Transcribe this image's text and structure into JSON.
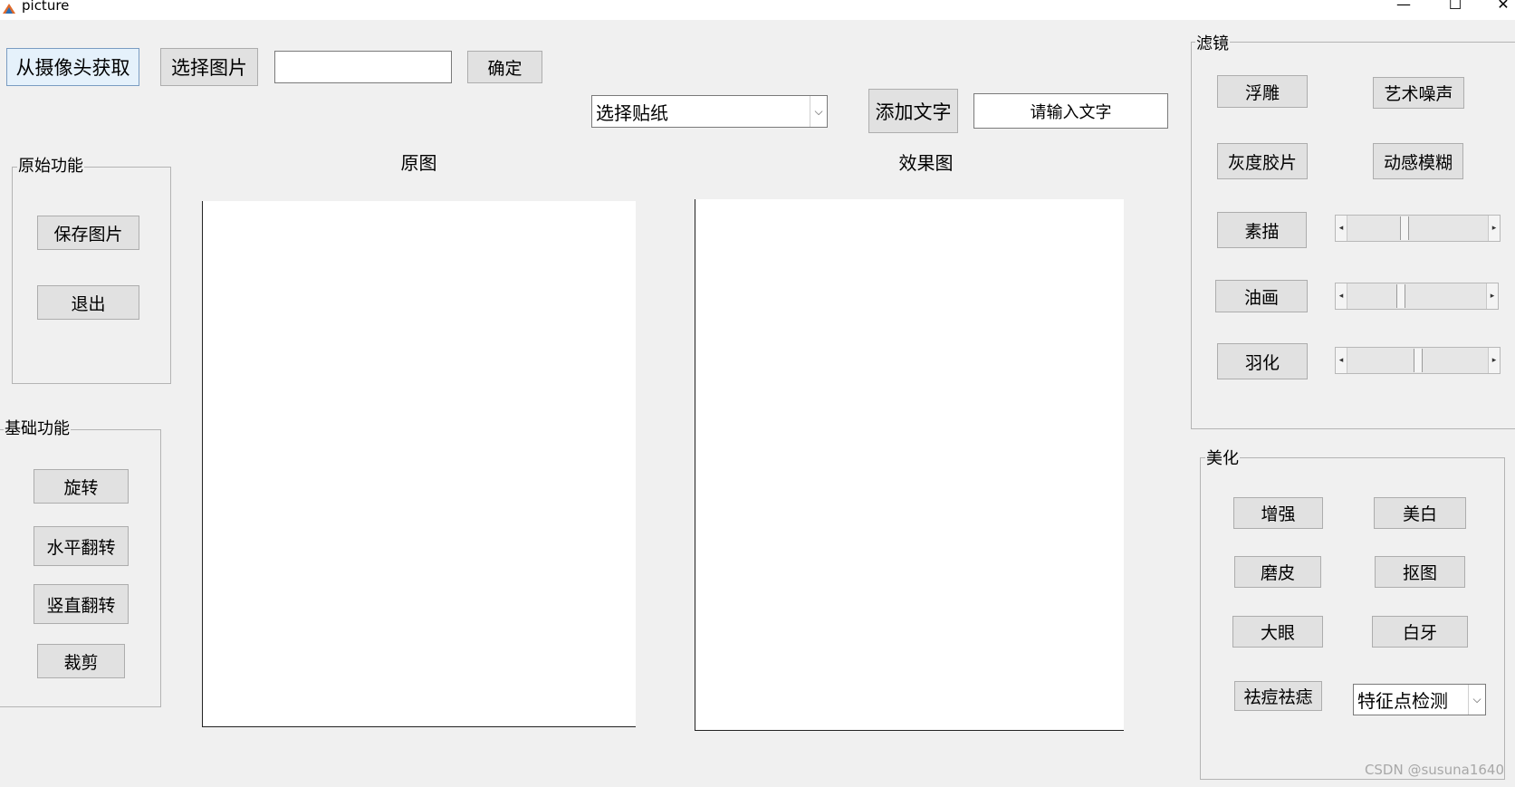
{
  "window": {
    "title": "picture",
    "minimize": "—",
    "maximize": "☐",
    "close": "✕"
  },
  "toolbar": {
    "camera_label": "从摄像头获取",
    "select_image_label": "选择图片",
    "path_value": "",
    "confirm_label": "确定",
    "sticker_select_value": "选择贴纸",
    "add_text_label": "添加文字",
    "text_input_value": "请输入文字"
  },
  "views": {
    "original_title": "原图",
    "effect_title": "效果图"
  },
  "original_functions": {
    "title": "原始功能",
    "save_label": "保存图片",
    "exit_label": "退出"
  },
  "basic_functions": {
    "title": "基础功能",
    "rotate_label": "旋转",
    "hflip_label": "水平翻转",
    "vflip_label": "竖直翻转",
    "crop_label": "裁剪"
  },
  "filters": {
    "title": "滤镜",
    "emboss_label": "浮雕",
    "art_noise_label": "艺术噪声",
    "gray_negative_label": "灰度胶片",
    "motion_blur_label": "动感模糊",
    "sketch_label": "素描",
    "oil_label": "油画",
    "feather_label": "羽化",
    "sketch_slider_value": 0.4,
    "oil_slider_value": 0.38,
    "feather_slider_value": 0.5
  },
  "beauty": {
    "title": "美化",
    "enhance_label": "增强",
    "whiten_label": "美白",
    "smooth_label": "磨皮",
    "matting_label": "抠图",
    "big_eye_label": "大眼",
    "white_teeth_label": "白牙",
    "acne_label": "祛痘祛痣",
    "feature_select_value": "特征点检测"
  },
  "watermark": "CSDN @susuna1640"
}
